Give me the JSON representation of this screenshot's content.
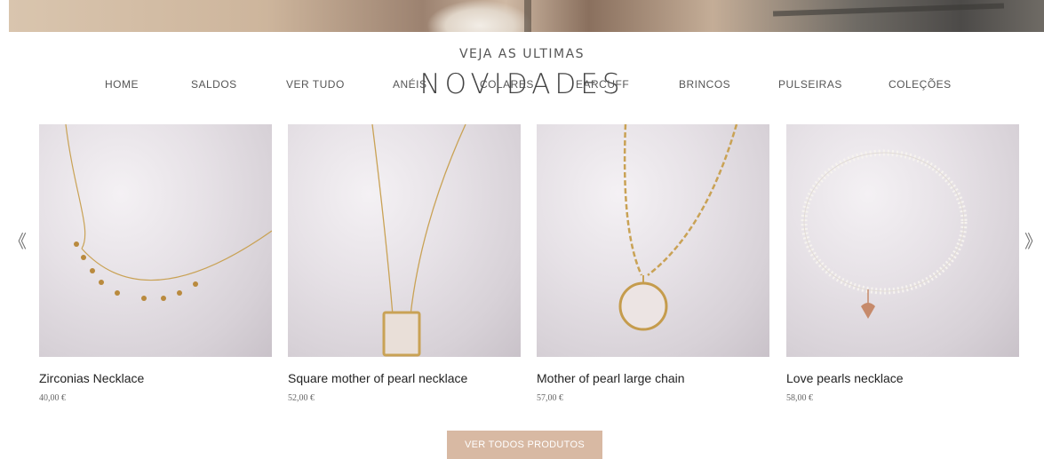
{
  "header": {
    "subtitle": "VEJA AS ULTIMAS",
    "headline": "NOVIDADES"
  },
  "nav": {
    "items": [
      "HOME",
      "SALDOS",
      "VER TUDO",
      "ANÉIS",
      "COLARES",
      "EARCUFF",
      "BRINCOS",
      "PULSEIRAS",
      "COLEÇÕES"
    ]
  },
  "carousel": {
    "prev_icon": "double-chevron-left-icon",
    "next_icon": "double-chevron-right-icon",
    "prev_glyph": "《",
    "next_glyph": "》"
  },
  "products": [
    {
      "name": "Zirconias Necklace",
      "price": "40,00 €"
    },
    {
      "name": "Square mother of pearl necklace",
      "price": "52,00 €"
    },
    {
      "name": "Mother of pearl large chain",
      "price": "57,00 €"
    },
    {
      "name": "Love pearls necklace",
      "price": "58,00 €"
    }
  ],
  "cta": {
    "label": "VER TODOS PRODUTOS",
    "color": "#d8b9a3"
  }
}
